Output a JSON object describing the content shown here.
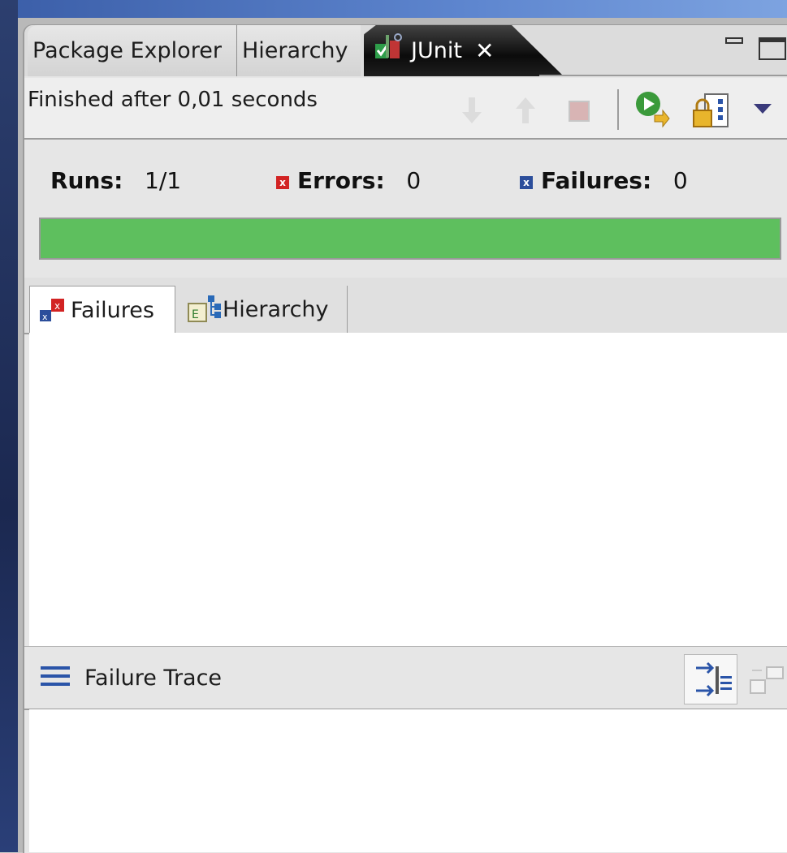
{
  "tabs": [
    {
      "label": "Package Explorer"
    },
    {
      "label": "Hierarchy"
    },
    {
      "label": "JUnit",
      "active": true,
      "icon": "junit-icon"
    }
  ],
  "status": {
    "finished": "Finished after 0,01 seconds"
  },
  "counters": {
    "runs_label": "Runs:",
    "runs_value": "1/1",
    "errors_label": "Errors:",
    "errors_value": "0",
    "failures_label": "Failures:",
    "failures_value": "0"
  },
  "progress": {
    "fraction": 1.0,
    "color": "#5ebf5e"
  },
  "subtabs": [
    {
      "label": "Failures",
      "active": true
    },
    {
      "label": "Hierarchy"
    }
  ],
  "trace": {
    "title": "Failure Trace"
  },
  "colors": {
    "error": "#d22323",
    "failure": "#2c4e9b",
    "active_tab": "#111111"
  }
}
